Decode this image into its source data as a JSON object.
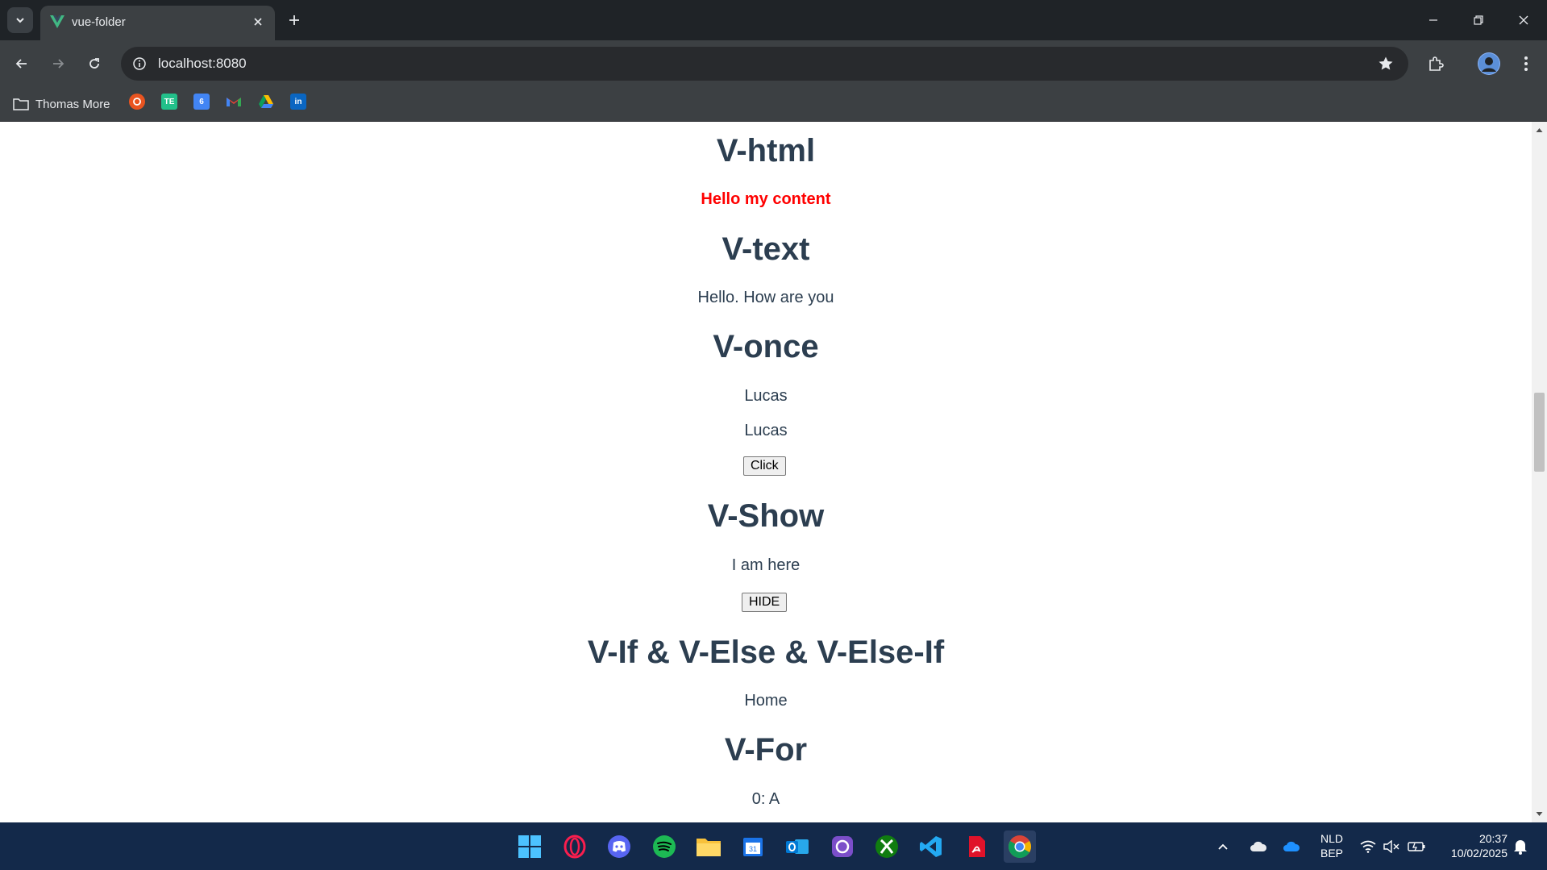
{
  "browser": {
    "tab_title": "vue-folder",
    "url": "localhost:8080",
    "bookmark_folder": "Thomas More",
    "bookmarks": [
      "Ubuntu",
      "TE",
      "Google Calendar",
      "Gmail",
      "Google Drive",
      "LinkedIn"
    ],
    "bookmark_te_label": "TE",
    "bookmark_cal_label": "6",
    "bookmark_in_label": "in"
  },
  "page": {
    "vhtml_heading": "V-html",
    "vhtml_content": "Hello my content",
    "vtext_heading": "V-text",
    "vtext_content": "Hello. How are you",
    "vonce_heading": "V-once",
    "vonce_name1": "Lucas",
    "vonce_name2": "Lucas",
    "vonce_button": "Click",
    "vshow_heading": "V-Show",
    "vshow_content": "I am here",
    "vshow_button": "HIDE",
    "vif_heading": "V-If & V-Else & V-Else-If",
    "vif_content": "Home",
    "vfor_heading": "V-For",
    "vfor_item": "0: A"
  },
  "taskbar": {
    "apps": [
      "Start",
      "Opera GX",
      "Discord",
      "Spotify",
      "File Explorer",
      "Calendar",
      "Outlook",
      "Screenshot",
      "Xbox",
      "Visual Studio Code",
      "Adobe Acrobat",
      "Google Chrome"
    ],
    "calendar_label": "31",
    "language_line1": "NLD",
    "language_line2": "BEP",
    "time": "20:37",
    "date": "10/02/2025"
  },
  "colors": {
    "heading": "#2c3e50",
    "red_text": "#ff0000",
    "taskbar": "#13294a",
    "chrome_dark": "#1f2327"
  }
}
